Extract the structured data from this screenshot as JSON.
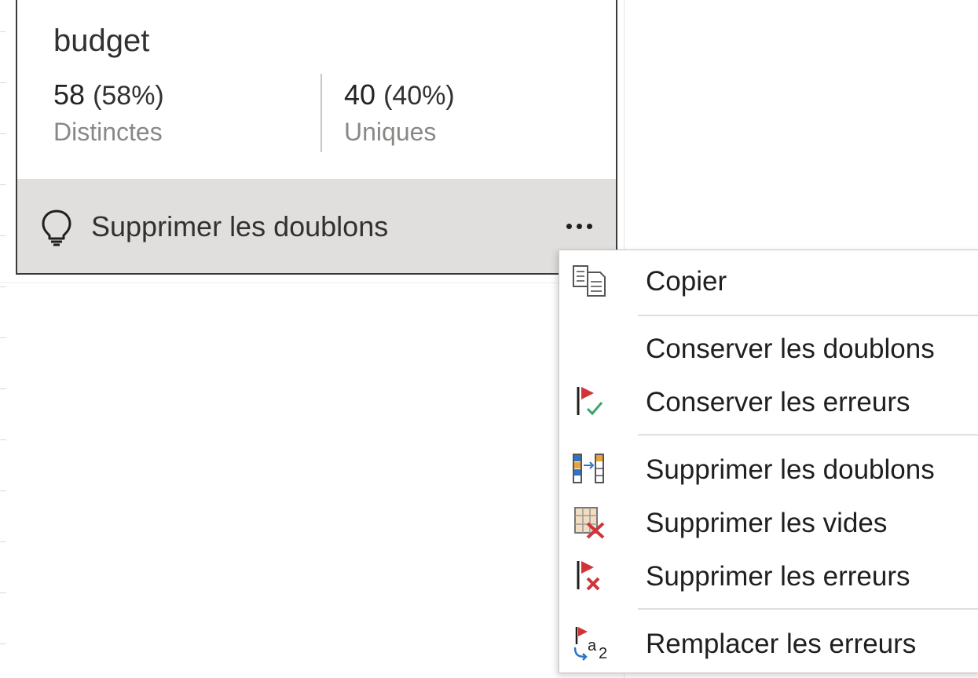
{
  "card": {
    "column_name": "budget",
    "distinct": {
      "count": "58",
      "percent": "(58%)",
      "label": "Distinctes"
    },
    "unique": {
      "count": "40",
      "percent": "(40%)",
      "label": "Uniques"
    },
    "suggestion": {
      "icon": "lightbulb-icon",
      "label": "Supprimer les doublons"
    },
    "more_icon": "more-options-icon"
  },
  "menu": {
    "items": [
      {
        "label": "Copier",
        "icon": "copy-icon"
      },
      {
        "label": "Conserver les doublons",
        "icon": ""
      },
      {
        "label": "Conserver les erreurs",
        "icon": "keep-errors-icon"
      },
      {
        "label": "Supprimer les doublons",
        "icon": "remove-duplicates-icon"
      },
      {
        "label": "Supprimer les vides",
        "icon": "remove-empty-icon"
      },
      {
        "label": "Supprimer les erreurs",
        "icon": "remove-errors-icon"
      },
      {
        "label": "Remplacer les erreurs",
        "icon": "replace-errors-icon"
      }
    ]
  },
  "colors": {
    "accent_red": "#d13438",
    "accent_green": "#3aa56a",
    "accent_blue": "#2b74c6",
    "suggest_bar": "#e1dfdd"
  }
}
